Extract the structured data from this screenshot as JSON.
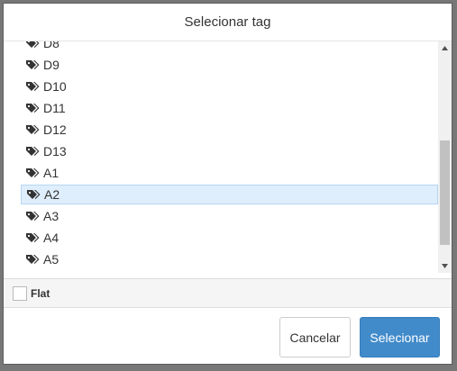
{
  "dialog": {
    "title": "Selecionar tag"
  },
  "tag_list": {
    "items": [
      {
        "label": "D8",
        "selected": false
      },
      {
        "label": "D9",
        "selected": false
      },
      {
        "label": "D10",
        "selected": false
      },
      {
        "label": "D11",
        "selected": false
      },
      {
        "label": "D12",
        "selected": false
      },
      {
        "label": "D13",
        "selected": false
      },
      {
        "label": "A1",
        "selected": false
      },
      {
        "label": "A2",
        "selected": true
      },
      {
        "label": "A3",
        "selected": false
      },
      {
        "label": "A4",
        "selected": false
      },
      {
        "label": "A5",
        "selected": false
      }
    ],
    "icon": "tags-icon"
  },
  "options": {
    "flat_label": "Flat",
    "flat_checked": false
  },
  "footer": {
    "cancel_label": "Cancelar",
    "select_label": "Selecionar"
  },
  "colors": {
    "accent": "#428bca",
    "selected_row": "#dfeefc",
    "overlay": "#777777"
  }
}
